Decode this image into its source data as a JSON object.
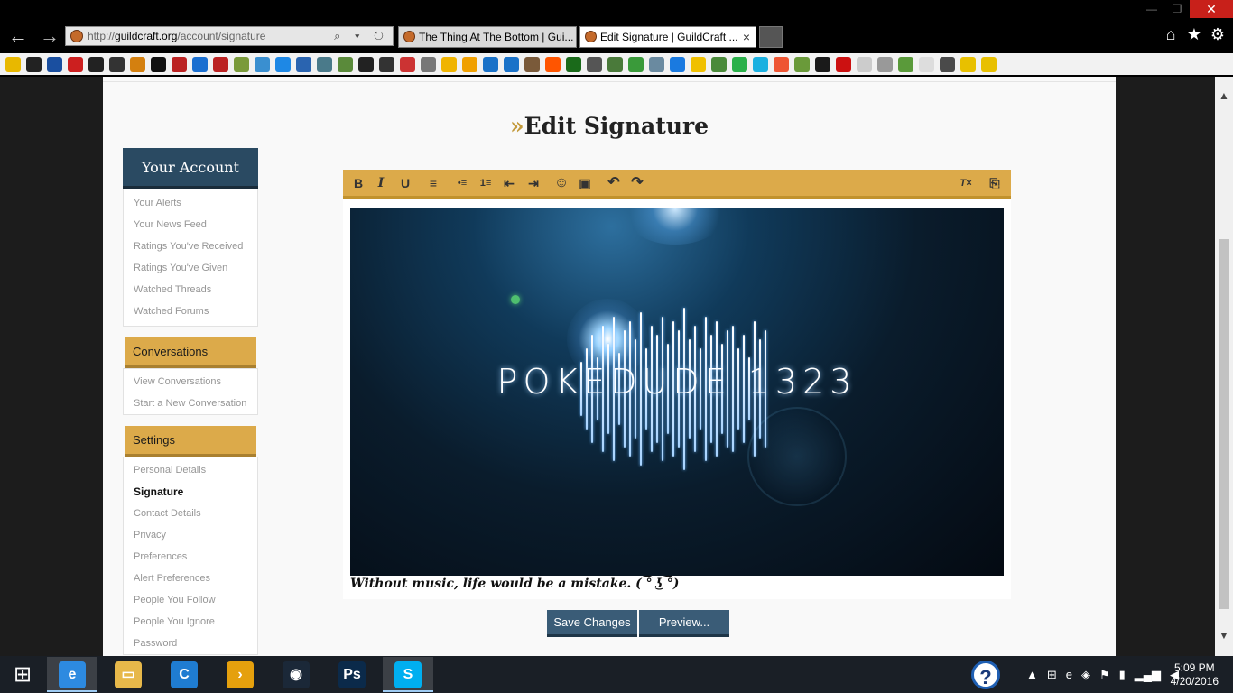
{
  "browser": {
    "address": {
      "prefix": "http://",
      "domain": "guildcraft.org",
      "path": "/account/signature",
      "tools": "⌕ ▾ ↻"
    },
    "tabs": [
      {
        "label": "The Thing At The Bottom | Gui..."
      },
      {
        "label": "Edit Signature | GuildCraft ...",
        "close": "×"
      }
    ],
    "window_controls": {
      "minimize": "—",
      "maximize": "❐",
      "close": "✕"
    },
    "right_icons": {
      "home": "⌂",
      "favorites": "★",
      "settings": "⚙"
    },
    "nav": {
      "back": "←",
      "forward": "→"
    }
  },
  "page": {
    "title_prefix": "»",
    "title": "Edit Signature"
  },
  "sidebar": {
    "account_heading": "Your Account",
    "account_items": [
      "Your Alerts",
      "Your News Feed",
      "Ratings You've Received",
      "Ratings You've Given",
      "Watched Threads",
      "Watched Forums"
    ],
    "conversations_heading": "Conversations",
    "conversations_items": [
      "View Conversations",
      "Start a New Conversation"
    ],
    "settings_heading": "Settings",
    "settings_items": [
      "Personal Details",
      "Signature",
      "Contact Details",
      "Privacy",
      "Preferences",
      "Alert Preferences",
      "People You Follow",
      "People You Ignore",
      "Password"
    ]
  },
  "editor": {
    "toolbar": {
      "bold": "B",
      "italic": "I",
      "underline": "U",
      "align": "≡",
      "bullets": "•≡",
      "numbered": "1≡",
      "outdent": "⇤",
      "indent": "⇥",
      "smilie": "☺",
      "image": "▣",
      "undo": "↶",
      "redo": "↷",
      "remove_format": "T×",
      "toggle_source": "⎘"
    },
    "signature_image_text": "POKEDUDE 1323",
    "signature_quote": "Without music, life would be a mistake. ( ͡° ͜ʖ ͡°)"
  },
  "buttons": {
    "save": "Save Changes",
    "preview": "Preview..."
  },
  "taskbar": {
    "start_icon": "⊞",
    "apps": [
      {
        "name": "internet-explorer",
        "glyph": "e",
        "color": "#2d8ae0"
      },
      {
        "name": "file-explorer",
        "glyph": "▭",
        "color": "#e7b84a"
      },
      {
        "name": "edge-like",
        "glyph": "C",
        "color": "#1f7cd1"
      },
      {
        "name": "plex",
        "glyph": "›",
        "color": "#e5a00d"
      },
      {
        "name": "steam",
        "glyph": "◉",
        "color": "#1b2838"
      },
      {
        "name": "photoshop",
        "glyph": "Ps",
        "color": "#0b2a4a"
      },
      {
        "name": "skype",
        "glyph": "S",
        "color": "#00aff0"
      }
    ],
    "help": "?",
    "time": "5:09 PM",
    "date": "4/20/2016"
  }
}
